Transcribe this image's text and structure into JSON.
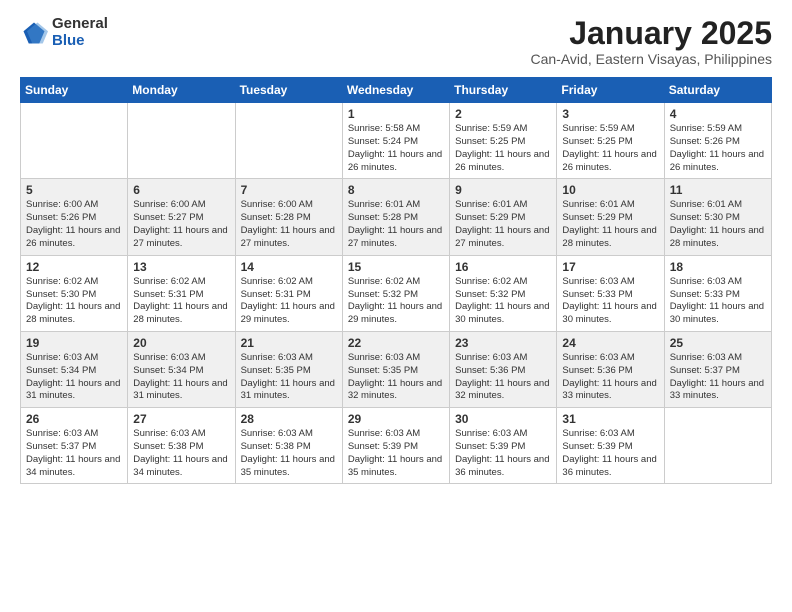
{
  "header": {
    "logo_general": "General",
    "logo_blue": "Blue",
    "month_title": "January 2025",
    "location": "Can-Avid, Eastern Visayas, Philippines"
  },
  "weekdays": [
    "Sunday",
    "Monday",
    "Tuesday",
    "Wednesday",
    "Thursday",
    "Friday",
    "Saturday"
  ],
  "weeks": [
    [
      {
        "day": "",
        "sunrise": "",
        "sunset": "",
        "daylight": ""
      },
      {
        "day": "",
        "sunrise": "",
        "sunset": "",
        "daylight": ""
      },
      {
        "day": "",
        "sunrise": "",
        "sunset": "",
        "daylight": ""
      },
      {
        "day": "1",
        "sunrise": "Sunrise: 5:58 AM",
        "sunset": "Sunset: 5:24 PM",
        "daylight": "Daylight: 11 hours and 26 minutes."
      },
      {
        "day": "2",
        "sunrise": "Sunrise: 5:59 AM",
        "sunset": "Sunset: 5:25 PM",
        "daylight": "Daylight: 11 hours and 26 minutes."
      },
      {
        "day": "3",
        "sunrise": "Sunrise: 5:59 AM",
        "sunset": "Sunset: 5:25 PM",
        "daylight": "Daylight: 11 hours and 26 minutes."
      },
      {
        "day": "4",
        "sunrise": "Sunrise: 5:59 AM",
        "sunset": "Sunset: 5:26 PM",
        "daylight": "Daylight: 11 hours and 26 minutes."
      }
    ],
    [
      {
        "day": "5",
        "sunrise": "Sunrise: 6:00 AM",
        "sunset": "Sunset: 5:26 PM",
        "daylight": "Daylight: 11 hours and 26 minutes."
      },
      {
        "day": "6",
        "sunrise": "Sunrise: 6:00 AM",
        "sunset": "Sunset: 5:27 PM",
        "daylight": "Daylight: 11 hours and 27 minutes."
      },
      {
        "day": "7",
        "sunrise": "Sunrise: 6:00 AM",
        "sunset": "Sunset: 5:28 PM",
        "daylight": "Daylight: 11 hours and 27 minutes."
      },
      {
        "day": "8",
        "sunrise": "Sunrise: 6:01 AM",
        "sunset": "Sunset: 5:28 PM",
        "daylight": "Daylight: 11 hours and 27 minutes."
      },
      {
        "day": "9",
        "sunrise": "Sunrise: 6:01 AM",
        "sunset": "Sunset: 5:29 PM",
        "daylight": "Daylight: 11 hours and 27 minutes."
      },
      {
        "day": "10",
        "sunrise": "Sunrise: 6:01 AM",
        "sunset": "Sunset: 5:29 PM",
        "daylight": "Daylight: 11 hours and 28 minutes."
      },
      {
        "day": "11",
        "sunrise": "Sunrise: 6:01 AM",
        "sunset": "Sunset: 5:30 PM",
        "daylight": "Daylight: 11 hours and 28 minutes."
      }
    ],
    [
      {
        "day": "12",
        "sunrise": "Sunrise: 6:02 AM",
        "sunset": "Sunset: 5:30 PM",
        "daylight": "Daylight: 11 hours and 28 minutes."
      },
      {
        "day": "13",
        "sunrise": "Sunrise: 6:02 AM",
        "sunset": "Sunset: 5:31 PM",
        "daylight": "Daylight: 11 hours and 28 minutes."
      },
      {
        "day": "14",
        "sunrise": "Sunrise: 6:02 AM",
        "sunset": "Sunset: 5:31 PM",
        "daylight": "Daylight: 11 hours and 29 minutes."
      },
      {
        "day": "15",
        "sunrise": "Sunrise: 6:02 AM",
        "sunset": "Sunset: 5:32 PM",
        "daylight": "Daylight: 11 hours and 29 minutes."
      },
      {
        "day": "16",
        "sunrise": "Sunrise: 6:02 AM",
        "sunset": "Sunset: 5:32 PM",
        "daylight": "Daylight: 11 hours and 30 minutes."
      },
      {
        "day": "17",
        "sunrise": "Sunrise: 6:03 AM",
        "sunset": "Sunset: 5:33 PM",
        "daylight": "Daylight: 11 hours and 30 minutes."
      },
      {
        "day": "18",
        "sunrise": "Sunrise: 6:03 AM",
        "sunset": "Sunset: 5:33 PM",
        "daylight": "Daylight: 11 hours and 30 minutes."
      }
    ],
    [
      {
        "day": "19",
        "sunrise": "Sunrise: 6:03 AM",
        "sunset": "Sunset: 5:34 PM",
        "daylight": "Daylight: 11 hours and 31 minutes."
      },
      {
        "day": "20",
        "sunrise": "Sunrise: 6:03 AM",
        "sunset": "Sunset: 5:34 PM",
        "daylight": "Daylight: 11 hours and 31 minutes."
      },
      {
        "day": "21",
        "sunrise": "Sunrise: 6:03 AM",
        "sunset": "Sunset: 5:35 PM",
        "daylight": "Daylight: 11 hours and 31 minutes."
      },
      {
        "day": "22",
        "sunrise": "Sunrise: 6:03 AM",
        "sunset": "Sunset: 5:35 PM",
        "daylight": "Daylight: 11 hours and 32 minutes."
      },
      {
        "day": "23",
        "sunrise": "Sunrise: 6:03 AM",
        "sunset": "Sunset: 5:36 PM",
        "daylight": "Daylight: 11 hours and 32 minutes."
      },
      {
        "day": "24",
        "sunrise": "Sunrise: 6:03 AM",
        "sunset": "Sunset: 5:36 PM",
        "daylight": "Daylight: 11 hours and 33 minutes."
      },
      {
        "day": "25",
        "sunrise": "Sunrise: 6:03 AM",
        "sunset": "Sunset: 5:37 PM",
        "daylight": "Daylight: 11 hours and 33 minutes."
      }
    ],
    [
      {
        "day": "26",
        "sunrise": "Sunrise: 6:03 AM",
        "sunset": "Sunset: 5:37 PM",
        "daylight": "Daylight: 11 hours and 34 minutes."
      },
      {
        "day": "27",
        "sunrise": "Sunrise: 6:03 AM",
        "sunset": "Sunset: 5:38 PM",
        "daylight": "Daylight: 11 hours and 34 minutes."
      },
      {
        "day": "28",
        "sunrise": "Sunrise: 6:03 AM",
        "sunset": "Sunset: 5:38 PM",
        "daylight": "Daylight: 11 hours and 35 minutes."
      },
      {
        "day": "29",
        "sunrise": "Sunrise: 6:03 AM",
        "sunset": "Sunset: 5:39 PM",
        "daylight": "Daylight: 11 hours and 35 minutes."
      },
      {
        "day": "30",
        "sunrise": "Sunrise: 6:03 AM",
        "sunset": "Sunset: 5:39 PM",
        "daylight": "Daylight: 11 hours and 36 minutes."
      },
      {
        "day": "31",
        "sunrise": "Sunrise: 6:03 AM",
        "sunset": "Sunset: 5:39 PM",
        "daylight": "Daylight: 11 hours and 36 minutes."
      },
      {
        "day": "",
        "sunrise": "",
        "sunset": "",
        "daylight": ""
      }
    ]
  ]
}
